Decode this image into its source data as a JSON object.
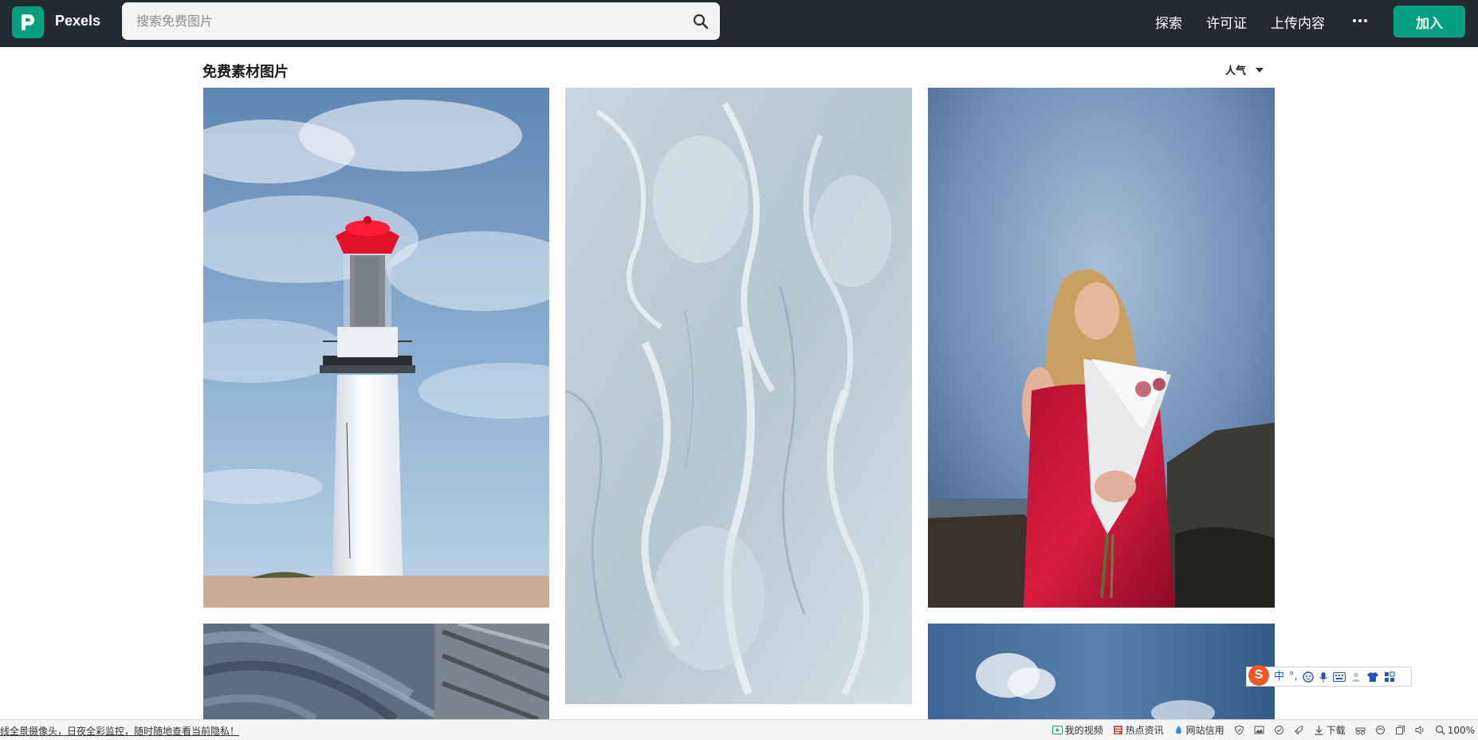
{
  "header": {
    "brand": "Pexels",
    "search_placeholder": "搜索免费图片",
    "nav": {
      "explore": "探索",
      "license": "许可证",
      "upload": "上传内容"
    },
    "join_label": "加入"
  },
  "content": {
    "title": "免费素材图片",
    "sort_label": "人气"
  },
  "photos": [
    {
      "subject": "lighthouse"
    },
    {
      "subject": "ice"
    },
    {
      "subject": "woman-with-bouquet"
    },
    {
      "subject": "marble-rock"
    },
    {
      "subject": "sky"
    }
  ],
  "ime": {
    "lang": "中",
    "punct": "°,"
  },
  "statusbar": {
    "left_text": "线全景摄像头，日夜全彩监控，随时随地查看当前隐私！",
    "my_video": "我的视频",
    "hot_news": "热点资讯",
    "site_credit": "网站信用",
    "download": "下载",
    "zoom": "100%"
  },
  "colors": {
    "header_bg": "#232a34",
    "brand_green": "#05a081",
    "ime_orange": "#ef5a24"
  }
}
